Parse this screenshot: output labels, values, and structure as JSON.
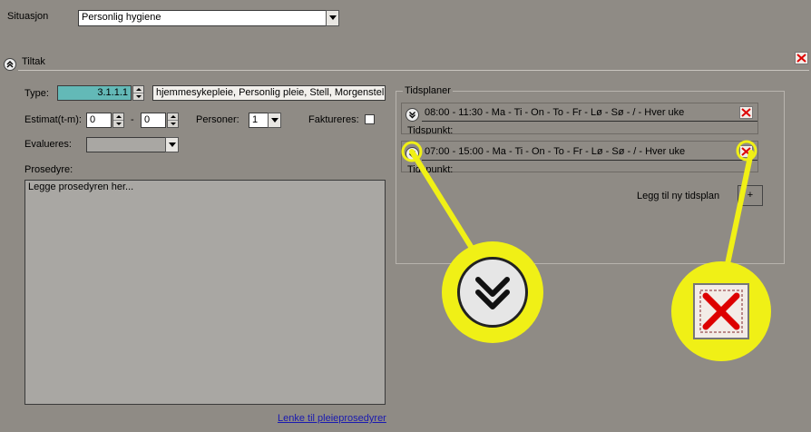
{
  "situation": {
    "label": "Situasjon",
    "value": "Personlig hygiene"
  },
  "tiltak": {
    "title": "Tiltak"
  },
  "form": {
    "type_label": "Type:",
    "type_value": "3.1.1.1",
    "type_desc": "hjemmesykepleie, Personlig pleie, Stell, Morgenstell",
    "estimat_label": "Estimat(t-m):",
    "estimat_hours": "0",
    "estimat_dash": "-",
    "estimat_minutes": "0",
    "personer_label": "Personer:",
    "personer_value": "1",
    "faktureres_label": "Faktureres:",
    "evalueres_label": "Evalueres:",
    "evalueres_value": "",
    "prosedyre_label": "Prosedyre:",
    "prosedyre_text": "Legge prosedyren her...",
    "link": "Lenke til pleieprosedyrer"
  },
  "tidsplaner": {
    "title": "Tidsplaner",
    "items": [
      {
        "text": "08:00 - 11:30 - Ma - Ti - On - To - Fr - Lø - Sø -  / - Hver uke",
        "sub_label": "Tidspunkt:"
      },
      {
        "text": "07:00 - 15:00 - Ma - Ti - On - To - Fr - Lø - Sø -  / - Hver uke",
        "sub_label": "Tidspunkt:"
      }
    ],
    "add_label": "Legg til ny tidsplan",
    "add_button": "+"
  },
  "colors": {
    "background": "#8f8b85",
    "type_field": "#63b9b7",
    "highlight": "#f0f016",
    "link": "#1a1ab0"
  }
}
